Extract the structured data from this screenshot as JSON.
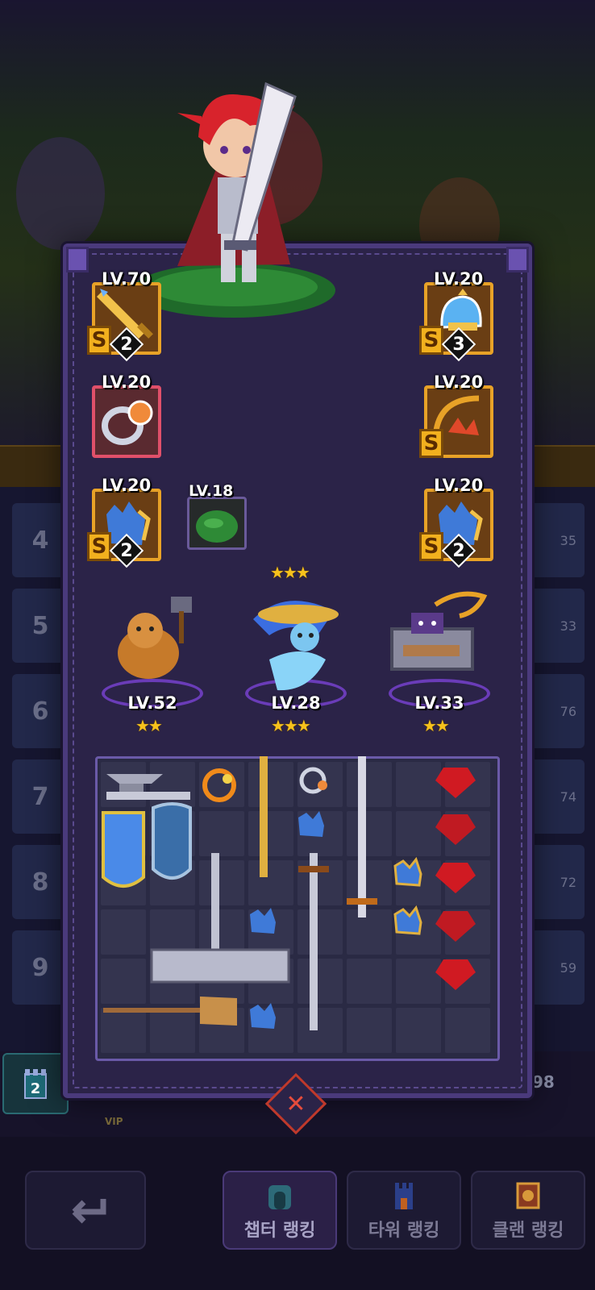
{
  "background": {
    "rank_numbers": [
      "4",
      "5",
      "6",
      "7",
      "8",
      "9"
    ],
    "score_fragments": [
      "35",
      "33",
      "76",
      "74",
      "72",
      "59"
    ],
    "my_score": "98",
    "vip_label": "VIP"
  },
  "hero": {
    "stars": "★★★",
    "equipment_left": [
      {
        "level": "LV.70",
        "grade": "S",
        "count": "2",
        "item": "sword"
      },
      {
        "level": "LV.20",
        "grade": "",
        "count": "",
        "item": "ring"
      },
      {
        "level": "LV.20",
        "grade": "S",
        "count": "2",
        "item": "glove"
      }
    ],
    "equipment_right": [
      {
        "level": "LV.20",
        "grade": "S",
        "count": "3",
        "item": "helmet"
      },
      {
        "level": "LV.20",
        "grade": "S",
        "count": "",
        "item": "bow"
      },
      {
        "level": "LV.20",
        "grade": "S",
        "count": "2",
        "item": "glove"
      }
    ],
    "pet_slot": {
      "level": "LV.18",
      "item": "slime"
    }
  },
  "companions": [
    {
      "level": "LV.52",
      "stars": "★★"
    },
    {
      "level": "LV.28",
      "stars": "★★★"
    },
    {
      "level": "LV.33",
      "stars": "★★"
    }
  ],
  "bottom_nav": {
    "back_icon": "back-arrow-icon",
    "chapter_ranking": "챕터 랭킹",
    "tower_ranking": "타워 랭킹",
    "clan_ranking": "클랜 랭킹"
  },
  "colors": {
    "accent_gold": "#f2b01e",
    "slot_border_gold": "#e8a227",
    "modal_border": "#4a3a7c",
    "close_red": "#e74c3c"
  }
}
